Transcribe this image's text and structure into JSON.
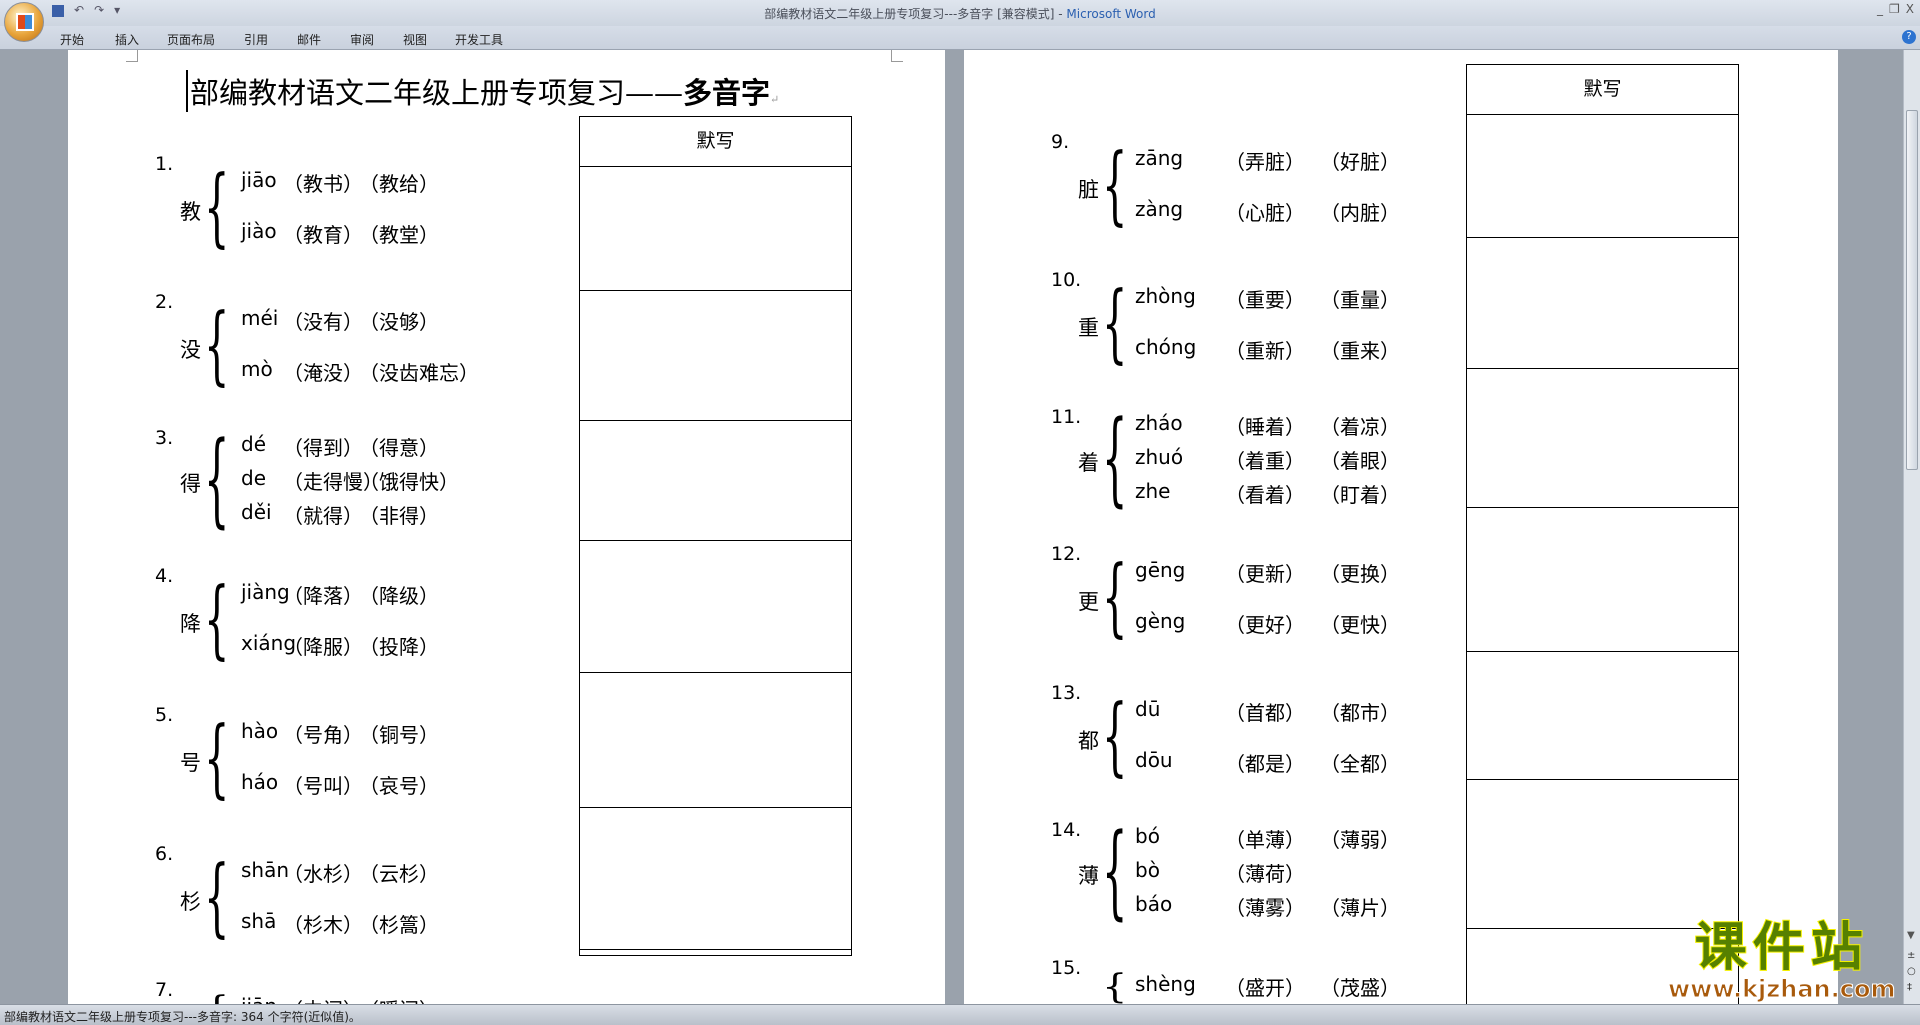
{
  "window": {
    "title": "部编教材语文二年级上册专项复习---多音字 [兼容模式]",
    "app_name": "Microsoft Word"
  },
  "ribbon_tabs": [
    "开始",
    "插入",
    "页面布局",
    "引用",
    "邮件",
    "审阅",
    "视图",
    "开发工具"
  ],
  "document": {
    "title_main": "部编教材语文二年级上册专项复习——",
    "title_suffix": "多音字",
    "table_header": "默写",
    "left_items": [
      {
        "number": "1.",
        "char": "教",
        "readings": [
          {
            "pinyin": "jiāo",
            "words": [
              "教书",
              "教给"
            ]
          },
          {
            "pinyin": "jiào",
            "words": [
              "教育",
              "教堂"
            ]
          }
        ]
      },
      {
        "number": "2.",
        "char": "没",
        "readings": [
          {
            "pinyin": "méi",
            "words": [
              "没有",
              "没够"
            ]
          },
          {
            "pinyin": "mò",
            "words": [
              "淹没",
              "没齿难忘"
            ]
          }
        ]
      },
      {
        "number": "3.",
        "char": "得",
        "readings": [
          {
            "pinyin": "dé",
            "words": [
              "得到",
              "得意"
            ]
          },
          {
            "pinyin": "de",
            "words": [
              "走得慢",
              "饿得快"
            ]
          },
          {
            "pinyin": "děi",
            "words": [
              "就得",
              "非得"
            ]
          }
        ]
      },
      {
        "number": "4.",
        "char": "降",
        "readings": [
          {
            "pinyin": "jiàng",
            "words": [
              "降落",
              "降级"
            ]
          },
          {
            "pinyin": "xiáng",
            "words": [
              "降服",
              "投降"
            ]
          }
        ]
      },
      {
        "number": "5.",
        "char": "号",
        "readings": [
          {
            "pinyin": "hào",
            "words": [
              "号角",
              "铜号"
            ]
          },
          {
            "pinyin": "háo",
            "words": [
              "号叫",
              "哀号"
            ]
          }
        ]
      },
      {
        "number": "6.",
        "char": "杉",
        "readings": [
          {
            "pinyin": "shān",
            "words": [
              "水杉",
              "云杉"
            ]
          },
          {
            "pinyin": "shā",
            "words": [
              "杉木",
              "杉篙"
            ]
          }
        ]
      },
      {
        "number": "7.",
        "char": "",
        "readings": [
          {
            "pinyin": "jiān",
            "words": [
              "中间",
              "瞬间"
            ]
          }
        ]
      }
    ],
    "right_items": [
      {
        "number": "9.",
        "char": "脏",
        "readings": [
          {
            "pinyin": "zāng",
            "words": [
              "弄脏",
              "好脏"
            ]
          },
          {
            "pinyin": "zàng",
            "words": [
              "心脏",
              "内脏"
            ]
          }
        ]
      },
      {
        "number": "10.",
        "char": "重",
        "readings": [
          {
            "pinyin": "zhòng",
            "words": [
              "重要",
              "重量"
            ]
          },
          {
            "pinyin": "chóng",
            "words": [
              "重新",
              "重来"
            ]
          }
        ]
      },
      {
        "number": "11.",
        "char": "着",
        "readings": [
          {
            "pinyin": "zháo",
            "words": [
              "睡着",
              "着凉"
            ]
          },
          {
            "pinyin": "zhuó",
            "words": [
              "着重",
              "着眼"
            ]
          },
          {
            "pinyin": "zhe",
            "words": [
              "看着",
              "盯着"
            ]
          }
        ]
      },
      {
        "number": "12.",
        "char": "更",
        "readings": [
          {
            "pinyin": "gēng",
            "words": [
              "更新",
              "更换"
            ]
          },
          {
            "pinyin": "gèng",
            "words": [
              "更好",
              "更快"
            ]
          }
        ]
      },
      {
        "number": "13.",
        "char": "都",
        "readings": [
          {
            "pinyin": "dū",
            "words": [
              "首都",
              "都市"
            ]
          },
          {
            "pinyin": "dōu",
            "words": [
              "都是",
              "全都"
            ]
          }
        ]
      },
      {
        "number": "14.",
        "char": "薄",
        "readings": [
          {
            "pinyin": "bó",
            "words": [
              "单薄",
              "薄弱"
            ]
          },
          {
            "pinyin": "bò",
            "words": [
              "薄荷"
            ]
          },
          {
            "pinyin": "báo",
            "words": [
              "薄雾",
              "薄片"
            ]
          }
        ]
      },
      {
        "number": "15.",
        "char": "",
        "readings": [
          {
            "pinyin": "shèng",
            "words": [
              "盛开",
              "茂盛"
            ]
          }
        ]
      }
    ]
  },
  "status_bar": {
    "text": "部编教材语文二年级上册专项复习---多音字: 364 个字符(近似值)。"
  },
  "watermark": {
    "name": "课件站",
    "url": "www.kjzhan.com"
  },
  "colors": {
    "watermark_green": "#568000",
    "watermark_outline": "#f4f000",
    "watermark_url": "#a85a0c",
    "title_app": "#2a5fb0"
  }
}
